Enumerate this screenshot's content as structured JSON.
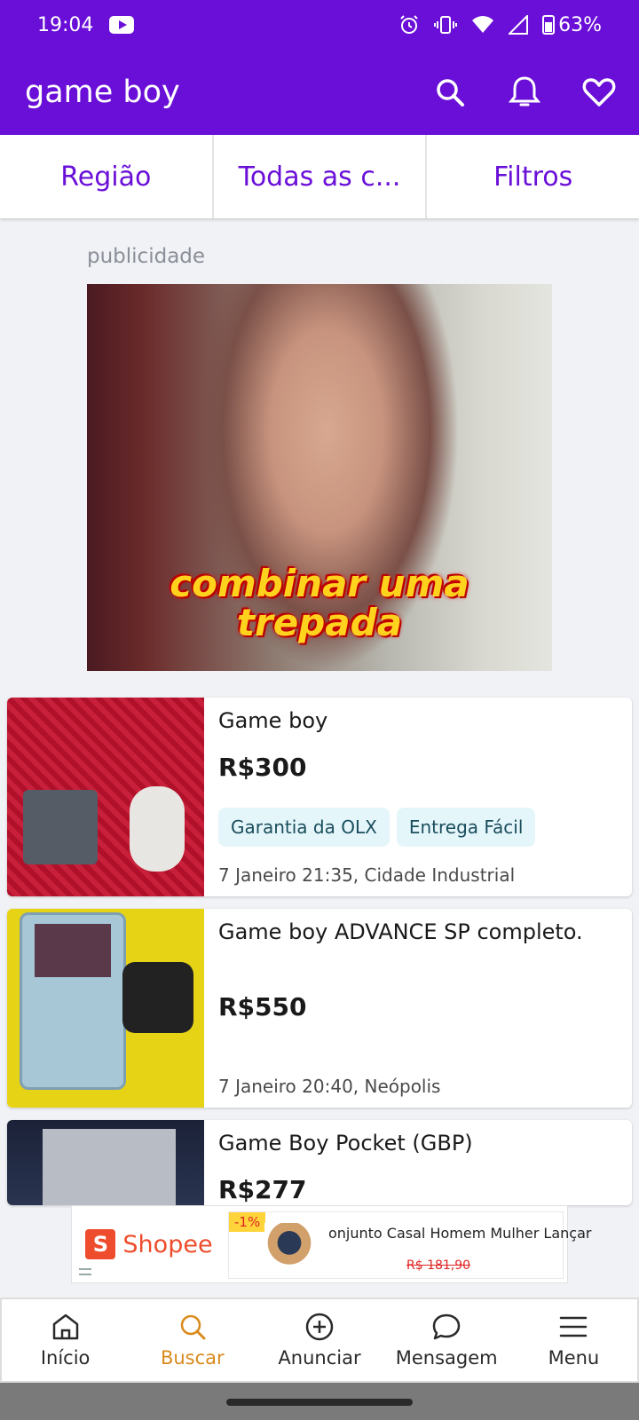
{
  "status_bar": {
    "time": "19:04",
    "battery": "63%",
    "icons": [
      "youtube-icon",
      "alarm-icon",
      "vibrate-icon",
      "wifi-icon",
      "signal-icon",
      "battery-icon"
    ]
  },
  "header": {
    "search_query": "game boy",
    "icons": [
      "search-icon",
      "bell-icon",
      "heart-icon"
    ],
    "background_color": "#6a0fd8"
  },
  "filters": {
    "region": "Região",
    "categories": "Todas as c...",
    "filters": "Filtros"
  },
  "ad": {
    "label": "publicidade",
    "caption_line1": "combinar uma",
    "caption_line2": "trepada"
  },
  "listings": [
    {
      "title": "Game boy",
      "price": "R$300",
      "badges": [
        "Garantia da OLX",
        "Entrega Fácil"
      ],
      "meta": "7 Janeiro 21:35, Cidade Industrial"
    },
    {
      "title": "Game boy ADVANCE SP completo.",
      "price": "R$550",
      "badges": [],
      "meta": "7 Janeiro 20:40, Neópolis"
    },
    {
      "title": "Game Boy Pocket (GBP)",
      "price": "R$277",
      "badges": [],
      "meta": ""
    }
  ],
  "shopee_banner": {
    "brand": "Shopee",
    "discount": "-1%",
    "product_name": "onjunto Casal Homem Mulher Lançar",
    "old_price": "R$ 181,90"
  },
  "bottom_nav": [
    {
      "label": "Início",
      "icon": "home-icon"
    },
    {
      "label": "Buscar",
      "icon": "search-icon",
      "active": true
    },
    {
      "label": "Anunciar",
      "icon": "plus-circle-icon"
    },
    {
      "label": "Mensagem",
      "icon": "chat-icon"
    },
    {
      "label": "Menu",
      "icon": "hamburger-icon"
    }
  ],
  "colors": {
    "brand_purple": "#6a0fd8",
    "active_nav": "#d98a1c",
    "shopee_orange": "#ee4d2d"
  }
}
